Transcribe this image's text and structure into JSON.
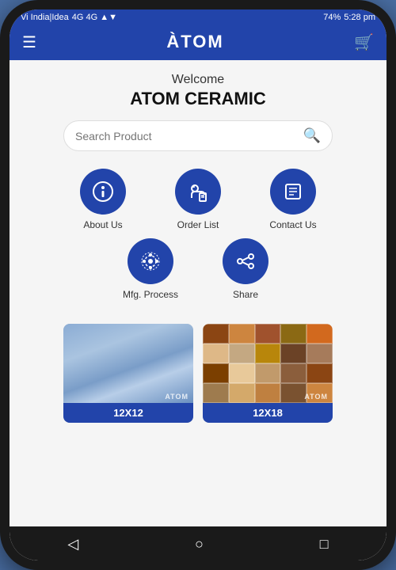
{
  "status_bar": {
    "carrier": "Vi India|Idea",
    "battery": "74%",
    "time": "5:28 pm"
  },
  "nav": {
    "logo": "ÀTOM",
    "cart_icon": "🛒"
  },
  "welcome": {
    "greeting": "Welcome",
    "company": "ATOM CERAMIC"
  },
  "search": {
    "placeholder": "Search Product"
  },
  "menu_items": [
    {
      "id": "about-us",
      "label": "About Us",
      "icon": "ℹ"
    },
    {
      "id": "order-list",
      "label": "Order List",
      "icon": "🛒"
    },
    {
      "id": "contact-us",
      "label": "Contact Us",
      "icon": "📋"
    },
    {
      "id": "mfg-process",
      "label": "Mfg. Process",
      "icon": "⚙"
    },
    {
      "id": "share",
      "label": "Share",
      "icon": "↗"
    }
  ],
  "products": [
    {
      "id": "12x12",
      "label": "12X12",
      "type": "blue"
    },
    {
      "id": "12x18",
      "label": "12X18",
      "type": "mosaic"
    }
  ],
  "watermark": "ATOM",
  "bottom_nav": {
    "back": "◁",
    "home": "○",
    "square": "□"
  }
}
